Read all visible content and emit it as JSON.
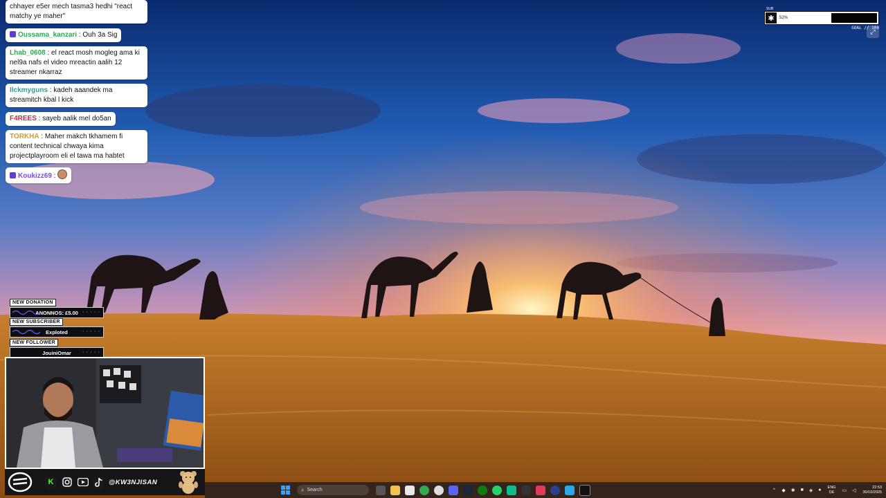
{
  "chat": {
    "messages": [
      {
        "user": "",
        "text": "chhayer e5er mech tasma3 hedhi \"react matchy ye maher\"",
        "color": "#111111",
        "badge": false,
        "full": true
      },
      {
        "user": "Oussama_kanzari",
        "text": " : Ouh 3a Sig",
        "color": "#2fa84f",
        "badge": true,
        "full": false
      },
      {
        "user": "Lhab_0608",
        "text": " : el react mosh mogleg ama ki nel9a nafs el video mreactin aalih 12 streamer nkarraz",
        "color": "#2fa84f",
        "badge": false,
        "full": true
      },
      {
        "user": "Ilckmyguns",
        "text": " : kadeh aaandek ma streamitch kbal l kick",
        "color": "#3a9a86",
        "badge": false,
        "full": true
      },
      {
        "user": "F4REES",
        "text": " : sayeb aalik mel do5an",
        "color": "#c0304a",
        "badge": false,
        "full": false
      },
      {
        "user": "TORKHA",
        "text": " : Maher makch tkhamem fi content technical chwaya kima projectplayroom eli el tawa ma habtet",
        "color": "#d39a2a",
        "badge": false,
        "full": true
      },
      {
        "user": "Koukizz69",
        "text": " :",
        "color": "#7a4fd6",
        "badge": true,
        "full": false,
        "emote": true
      }
    ]
  },
  "alerts": [
    {
      "title": "NEW DONATION",
      "value": "ANONNOS: £5.00"
    },
    {
      "title": "NEW SUBSCRIBER",
      "value": "Exploted"
    },
    {
      "title": "NEW FOLLOWER",
      "value": "JouiniOmar"
    }
  ],
  "alerts_dots": "· · · · ·",
  "goal": {
    "label": "SUB",
    "percent": "52%",
    "text": "GOAL // 100"
  },
  "socials": {
    "handle": "@KW3NJISAN",
    "icons": [
      "kick-icon",
      "instagram-icon",
      "youtube-icon",
      "tiktok-icon"
    ]
  },
  "taskbar": {
    "search_placeholder": "Search",
    "lang_top": "ENG",
    "lang_bottom": "DE",
    "time": "22:53",
    "date": "30/10/2025"
  },
  "colors": {
    "kick": "#53fc18",
    "instagram": "#c13584",
    "youtube": "#ff0000",
    "tiktok": "#111111"
  }
}
